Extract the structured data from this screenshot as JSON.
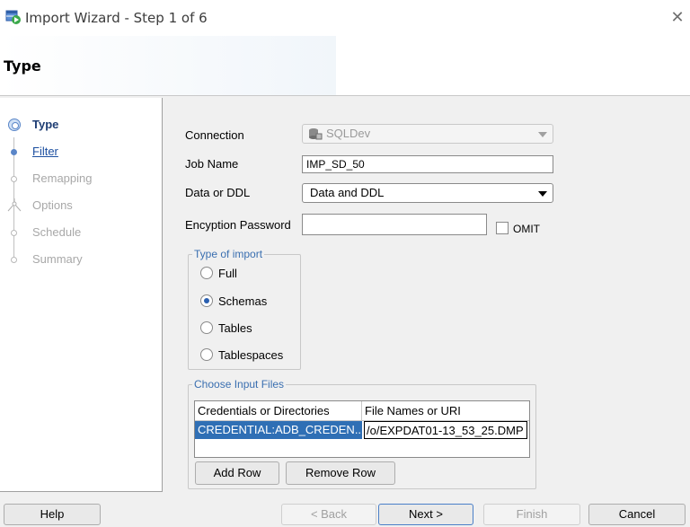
{
  "window": {
    "title": "Import Wizard - Step 1 of 6",
    "close_glyph": "✕"
  },
  "header": {
    "title": "Type"
  },
  "steps": [
    {
      "label": "Type"
    },
    {
      "label": "Filter"
    },
    {
      "label": "Remapping"
    },
    {
      "label": "Options"
    },
    {
      "label": "Schedule"
    },
    {
      "label": "Summary"
    }
  ],
  "form": {
    "connection_label": "Connection",
    "connection_value": "SQLDev",
    "job_name_label": "Job Name",
    "job_name_value": "IMP_SD_50",
    "data_ddl_label": "Data or DDL",
    "data_ddl_value": "Data and DDL",
    "password_label": "Encyption Password",
    "password_value": "",
    "omit_label": "OMIT"
  },
  "import_type": {
    "legend": "Type of import",
    "options": [
      "Full",
      "Schemas",
      "Tables",
      "Tablespaces"
    ],
    "selected": "Schemas"
  },
  "input_files": {
    "legend": "Choose Input Files",
    "columns": [
      "Credentials or Directories",
      "File Names or URI"
    ],
    "rows": [
      {
        "credential": "CREDENTIAL:ADB_CREDEN...",
        "uri": "/o/EXPDAT01-13_53_25.DMP"
      }
    ],
    "add_row": "Add Row",
    "remove_row": "Remove Row"
  },
  "footer": {
    "help": "Help",
    "back": "< Back",
    "next": "Next >",
    "finish": "Finish",
    "cancel": "Cancel"
  },
  "colors": {
    "active_step": "#1e3d73",
    "link": "#1c4fa0",
    "group_legend": "#3a6fb0",
    "selection": "#2f6fb5"
  }
}
